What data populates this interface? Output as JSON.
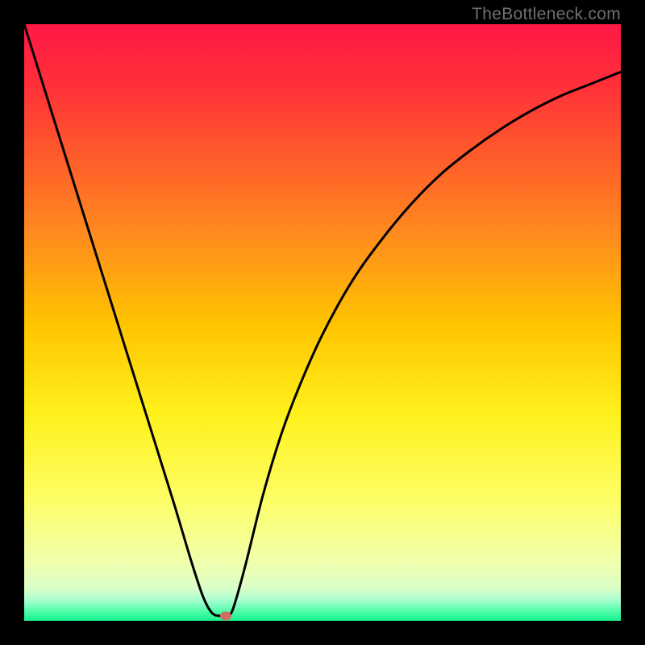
{
  "watermark": "TheBottleneck.com",
  "chart_data": {
    "type": "line",
    "title": "",
    "xlabel": "",
    "ylabel": "",
    "xlim": [
      0,
      100
    ],
    "ylim": [
      0,
      100
    ],
    "background_gradient": {
      "stops": [
        {
          "pos": 0.0,
          "color": "#ff1846"
        },
        {
          "pos": 0.1,
          "color": "#ff2f39"
        },
        {
          "pos": 0.22,
          "color": "#ff5b2b"
        },
        {
          "pos": 0.35,
          "color": "#ff8a1f"
        },
        {
          "pos": 0.5,
          "color": "#ffc300"
        },
        {
          "pos": 0.65,
          "color": "#fff01a"
        },
        {
          "pos": 0.8,
          "color": "#fdff68"
        },
        {
          "pos": 0.9,
          "color": "#f2ffac"
        },
        {
          "pos": 0.945,
          "color": "#daffc8"
        },
        {
          "pos": 0.965,
          "color": "#a9ffd0"
        },
        {
          "pos": 0.985,
          "color": "#4cfca8"
        },
        {
          "pos": 1.0,
          "color": "#17f08e"
        }
      ]
    },
    "series": [
      {
        "name": "bottleneck-curve",
        "x": [
          0,
          5,
          10,
          15,
          20,
          25,
          28,
          30,
          31.5,
          33,
          34,
          35,
          37,
          40,
          43,
          46,
          50,
          55,
          60,
          65,
          70,
          75,
          80,
          85,
          90,
          95,
          100
        ],
        "y": [
          100,
          84,
          68,
          52,
          36,
          20,
          10,
          4,
          1.3,
          0.8,
          0.8,
          2,
          9,
          21,
          31,
          39,
          48,
          57,
          64,
          70,
          75,
          79,
          82.5,
          85.5,
          88,
          90,
          92
        ]
      }
    ],
    "marker": {
      "x": 33.8,
      "y": 0.8,
      "color": "#cf6d5f"
    }
  }
}
